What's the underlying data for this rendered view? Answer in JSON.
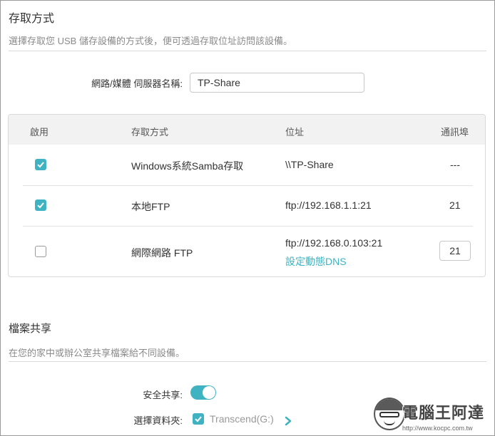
{
  "access": {
    "title": "存取方式",
    "description": "選擇存取您 USB 儲存設備的方式後，便可透過存取位址訪問該設備。",
    "server_name_label": "網路/媒體 伺服器名稱:",
    "server_name_value": "TP-Share",
    "table": {
      "headers": {
        "enable": "啟用",
        "method": "存取方式",
        "address": "位址",
        "port": "通訊埠"
      },
      "rows": [
        {
          "enabled": true,
          "method": "Windows系統Samba存取",
          "address": "\\\\TP-Share",
          "port": "---"
        },
        {
          "enabled": true,
          "method": "本地FTP",
          "address": "ftp://192.168.1.1:21",
          "port": "21"
        },
        {
          "enabled": false,
          "method": "網際網路 FTP",
          "address": "ftp://192.168.0.103:21",
          "link": "設定動態DNS",
          "port": "21"
        }
      ]
    }
  },
  "sharing": {
    "title": "檔案共享",
    "description": "在您的家中或辦公室共享檔案給不同設備。",
    "secure_label": "安全共享:",
    "secure_on": true,
    "folder_label": "選擇資料夾:",
    "folder_value": "Transcend(G:)",
    "folder_checked": true
  },
  "watermark": {
    "title": "電腦王阿達",
    "url": "http://www.kocpc.com.tw"
  },
  "colors": {
    "accent": "#3fb3c2",
    "divider": "#d9d9d9",
    "header_bg": "#f2f2f2"
  }
}
